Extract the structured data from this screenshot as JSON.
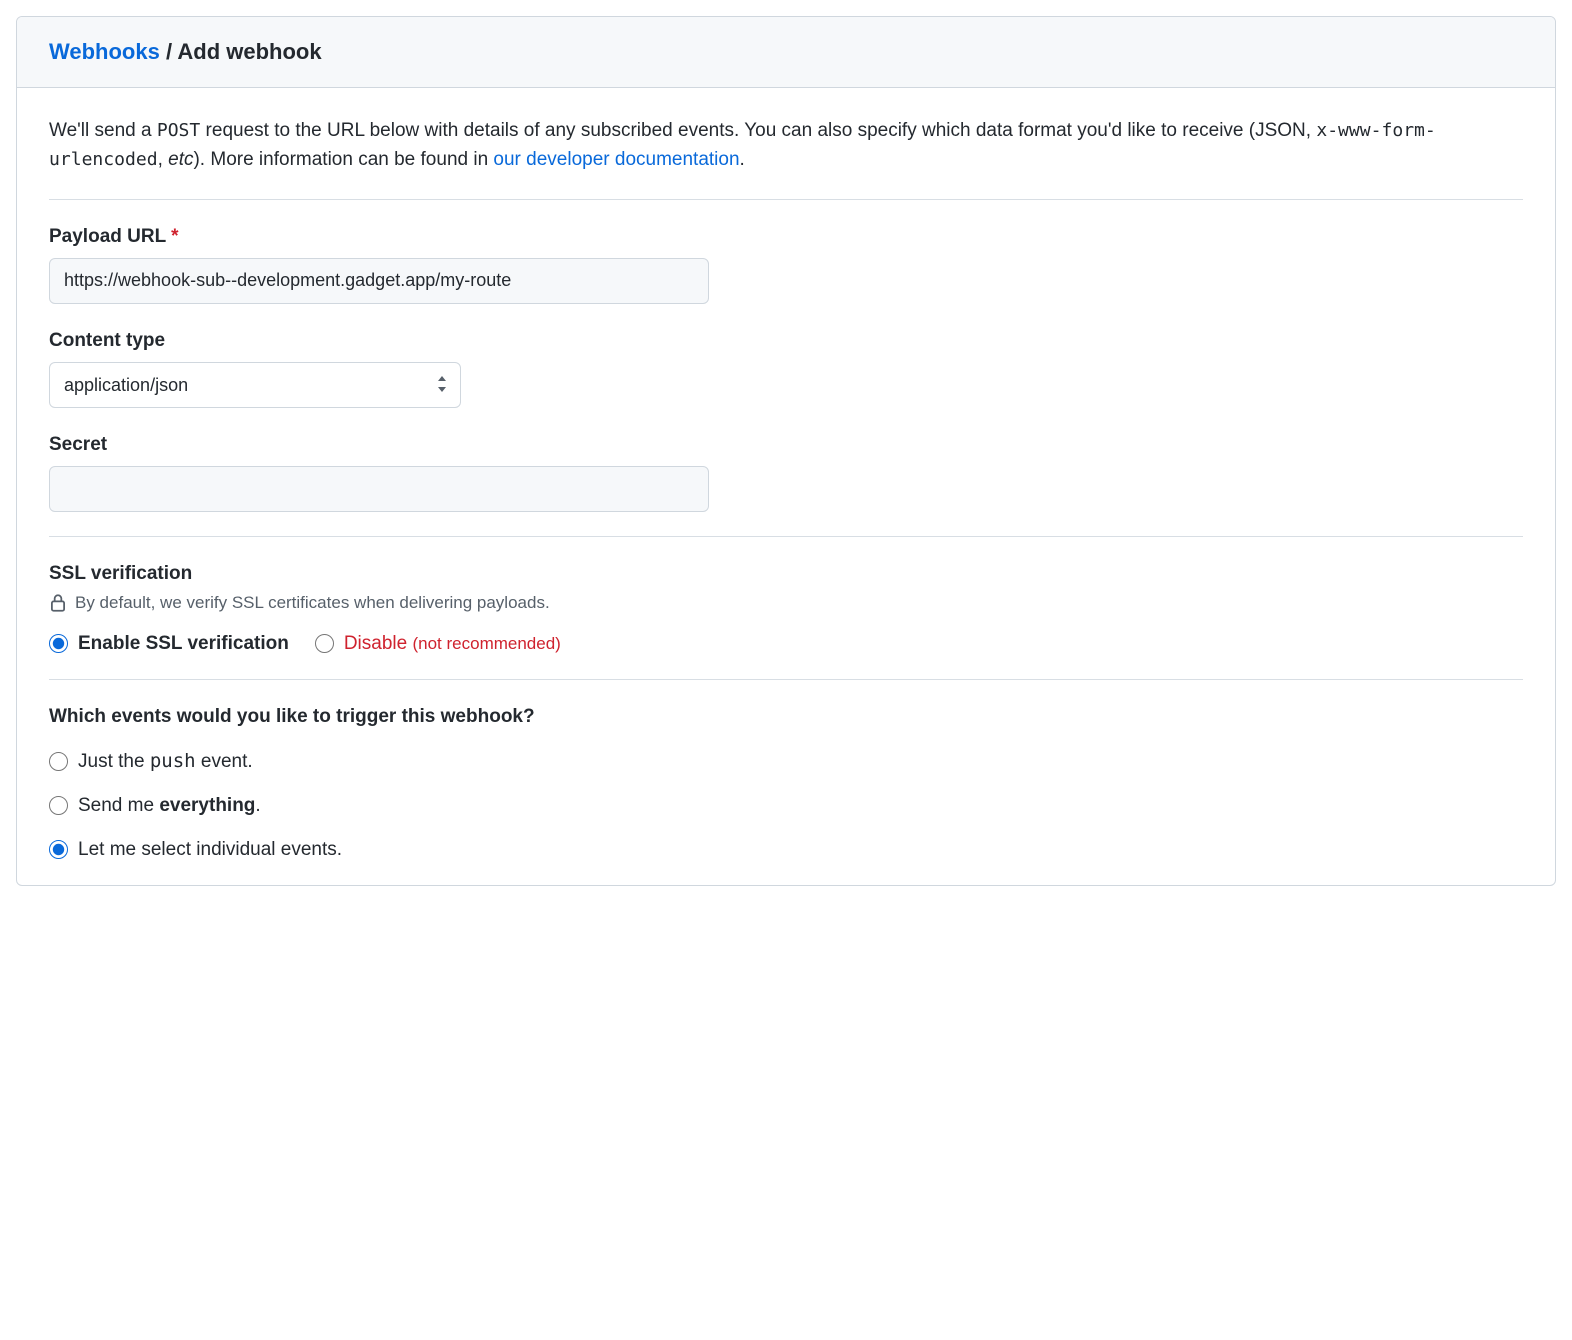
{
  "breadcrumb": {
    "root": "Webhooks",
    "separator": "/",
    "current": "Add webhook"
  },
  "intro": {
    "t1": "We'll send a ",
    "code1": "POST",
    "t2": " request to the URL below with details of any subscribed events. You can also specify which data format you'd like to receive (JSON, ",
    "code2": "x-www-form-urlencoded",
    "t3": ", ",
    "em": "etc",
    "t4": "). More information can be found in ",
    "link": "our developer documentation",
    "t5": "."
  },
  "payload_url": {
    "label": "Payload URL",
    "required_mark": "*",
    "value": "https://webhook-sub--development.gadget.app/my-route"
  },
  "content_type": {
    "label": "Content type",
    "value": "application/json"
  },
  "secret": {
    "label": "Secret",
    "value": ""
  },
  "ssl": {
    "heading": "SSL verification",
    "description": "By default, we verify SSL certificates when delivering payloads.",
    "enable_label": "Enable SSL verification",
    "disable_label": "Disable",
    "disable_paren": "(not recommended)"
  },
  "events": {
    "heading": "Which events would you like to trigger this webhook?",
    "opt1_a": "Just the ",
    "opt1_code": "push",
    "opt1_b": " event.",
    "opt2_a": "Send me ",
    "opt2_bold": "everything",
    "opt2_b": ".",
    "opt3": "Let me select individual events."
  }
}
